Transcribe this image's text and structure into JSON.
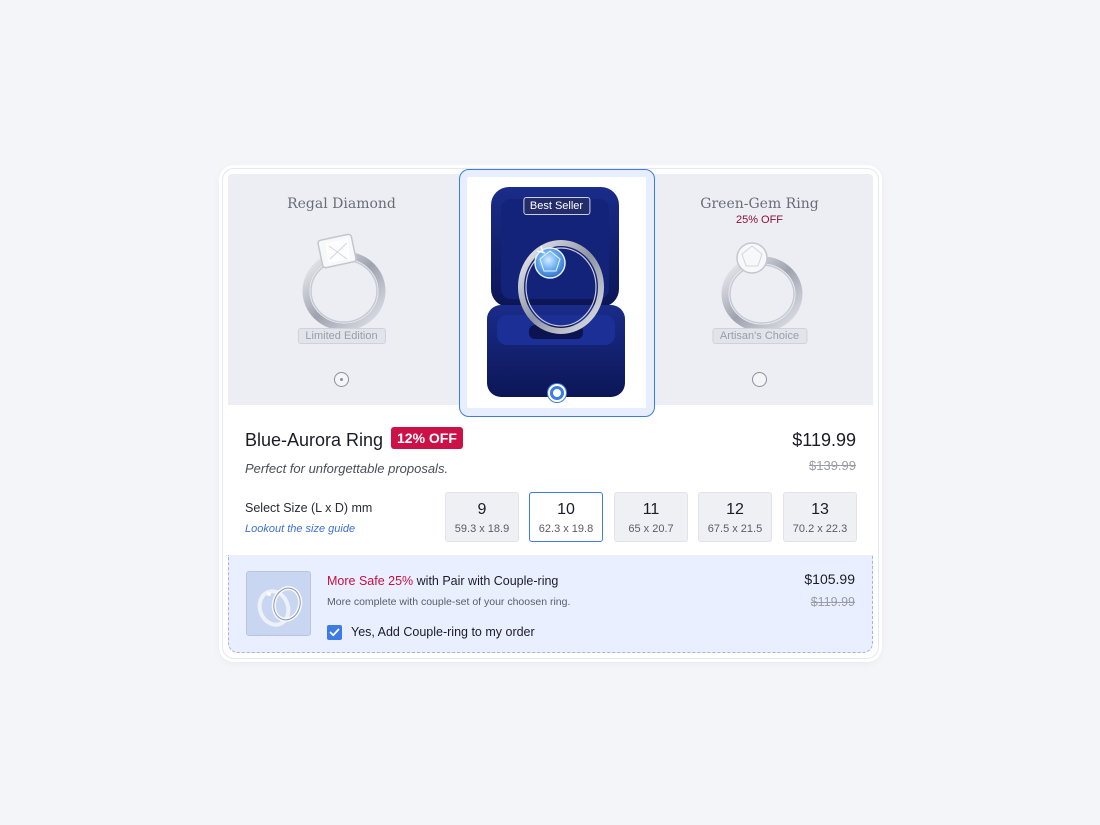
{
  "options": {
    "left": {
      "title": "Regal Diamond",
      "tag": "Limited Edition"
    },
    "center": {
      "badge": "Best Seller"
    },
    "right": {
      "title": "Green-Gem Ring",
      "discount": "25% OFF",
      "tag": "Artisan's Choice"
    }
  },
  "product": {
    "name": "Blue-Aurora Ring",
    "discount_badge": "12% OFF",
    "description": "Perfect for unforgettable proposals.",
    "price": "$119.99",
    "old_price": "$139.99"
  },
  "size_selector": {
    "label": "Select Size (L x D) mm",
    "guide_link": "Lookout the size guide",
    "selected": "10",
    "sizes": [
      {
        "num": "9",
        "dim": "59.3 x 18.9"
      },
      {
        "num": "10",
        "dim": "62.3 x 19.8"
      },
      {
        "num": "11",
        "dim": "65 x 20.7"
      },
      {
        "num": "12",
        "dim": "67.5 x 21.5"
      },
      {
        "num": "13",
        "dim": "70.2 x 22.3"
      }
    ]
  },
  "addon": {
    "title_highlight": "More Safe 25%",
    "title_rest": " with Pair with Couple-ring",
    "description": "More complete with couple-set of your choosen ring.",
    "checkbox_label": "Yes, Add Couple-ring to my order",
    "checked": true,
    "price": "$105.99",
    "old_price": "$119.99"
  },
  "colors": {
    "accent": "#3d7be5",
    "discount_red": "#cc1148",
    "addon_bg": "#eaefff"
  }
}
